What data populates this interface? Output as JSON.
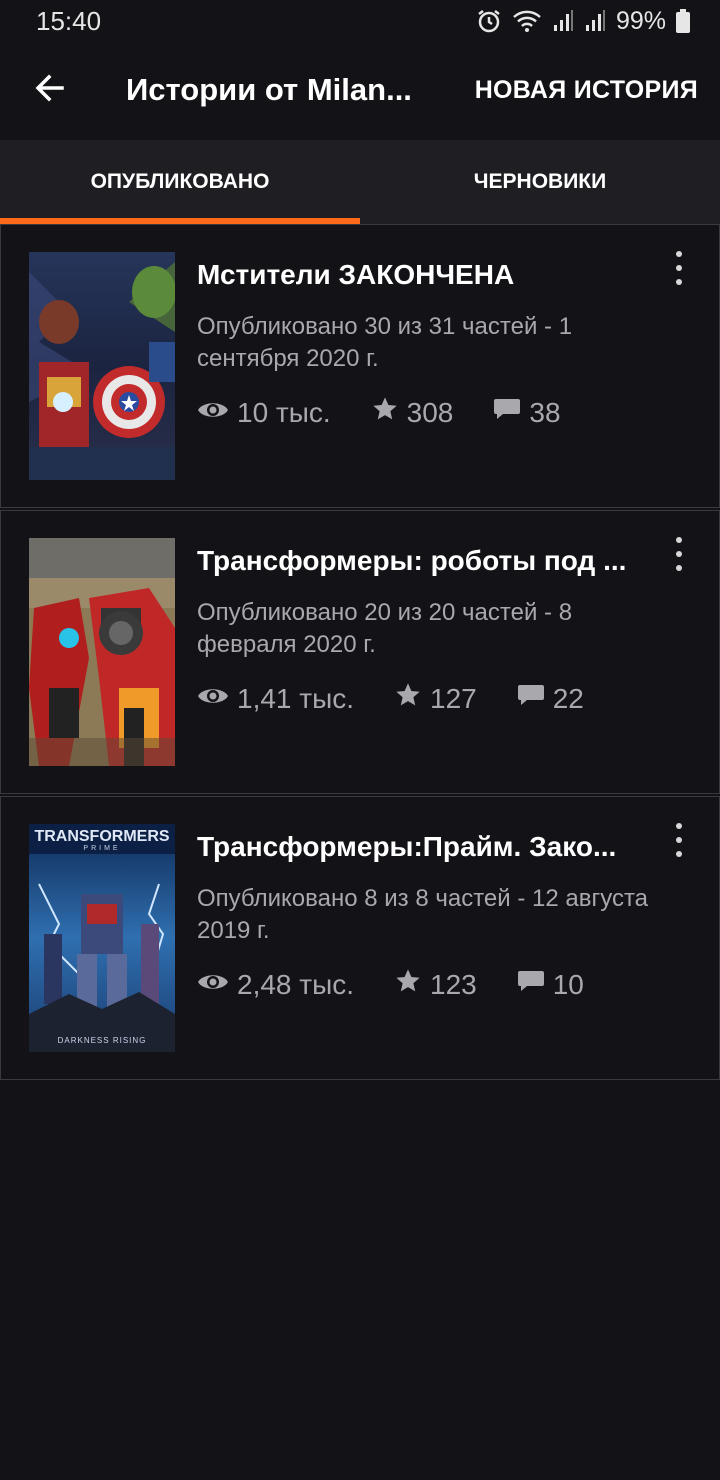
{
  "status_bar": {
    "time": "15:40",
    "battery": "99%",
    "icons": [
      "alarm-icon",
      "wifi-icon",
      "signal-icon",
      "signal-icon",
      "battery-icon"
    ]
  },
  "app_bar": {
    "back_icon": "arrow-left-icon",
    "title": "Истории от Milan...",
    "new_story_label": "НОВАЯ ИСТОРИЯ"
  },
  "tabs": [
    {
      "label": "ОПУБЛИКОВАНО",
      "active": true
    },
    {
      "label": "ЧЕРНОВИКИ",
      "active": false
    }
  ],
  "accent_color": "#ff6a1a",
  "stories": [
    {
      "title": "Мстители ЗАКОНЧЕНА",
      "meta": "Опубликовано 30 из 31 частей - 1 сентября 2020 г.",
      "views": "10 тыс.",
      "votes": "308",
      "comments": "38"
    },
    {
      "title": "Трансформеры: роботы под ...",
      "meta": "Опубликовано 20 из 20 частей - 8 февраля 2020 г.",
      "views": "1,41 тыс.",
      "votes": "127",
      "comments": "22"
    },
    {
      "title": "Трансформеры:Прайм. Зако...",
      "meta": "Опубликовано 8 из 8 частей - 12 августа 2019 г.",
      "views": "2,48 тыс.",
      "votes": "123",
      "comments": "10",
      "cover_text_top": "TRANSFORMERS",
      "cover_text_sub": "PRIME",
      "cover_text_bottom": "DARKNESS RISING"
    }
  ]
}
